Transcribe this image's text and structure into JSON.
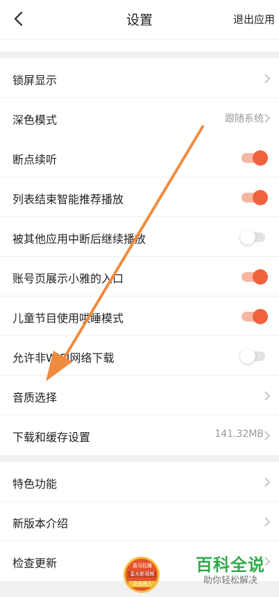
{
  "header": {
    "title": "设置",
    "exit_label": "退出应用"
  },
  "group1": [
    {
      "label": "锁屏显示",
      "value": ""
    },
    {
      "label": "深色模式",
      "value": "跟随系统"
    }
  ],
  "group2": [
    {
      "label": "断点续听",
      "on": true
    },
    {
      "label": "列表结束智能推荐播放",
      "on": true
    },
    {
      "label": "被其他应用中断后继续播放",
      "on": false
    },
    {
      "label": "账号页展示小雅的入口",
      "on": true
    },
    {
      "label": "儿童节目使用哄睡模式",
      "on": true
    },
    {
      "label": "允许非WIFI网络下载",
      "on": false
    },
    {
      "label": "音质选择",
      "value": ""
    },
    {
      "label": "下载和缓存设置",
      "value": "141.32MB"
    }
  ],
  "group3": [
    {
      "label": "特色功能"
    },
    {
      "label": "新版本介绍"
    },
    {
      "label": "检查更新"
    }
  ],
  "badge": {
    "line1": "喜马拉雅",
    "line2": "星光影视频",
    "line3": "点击进入"
  },
  "watermark": {
    "title": "百科全说",
    "subtitle": "助你轻松解决"
  },
  "colors": {
    "accent": "#f0623d",
    "annotation_arrow": "#f08a3e",
    "watermark_green": "#2faa4a"
  }
}
